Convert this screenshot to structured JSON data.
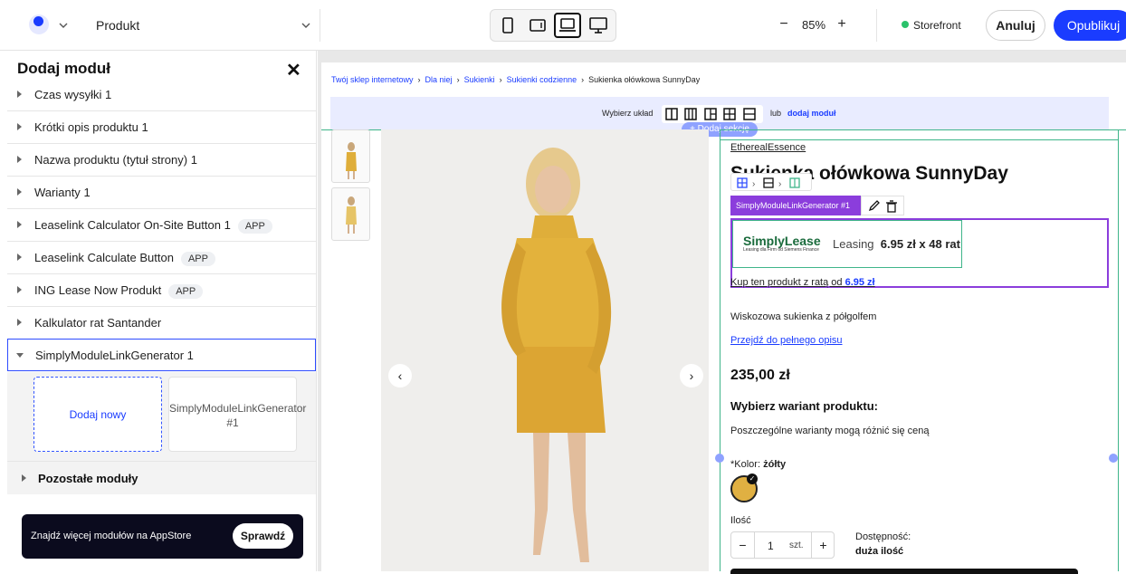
{
  "topbar": {
    "product_select": "Produkt",
    "zoom_value": "85%",
    "zoom_minus": "−",
    "zoom_plus": "+",
    "storefront": "Storefront",
    "cancel": "Anuluj",
    "publish": "Opublikuj",
    "devices": [
      "mobile-icon",
      "tablet-icon",
      "laptop-icon",
      "desktop-icon"
    ],
    "active_device": "laptop-icon"
  },
  "sidebar": {
    "title": "Dodaj moduł",
    "modules": [
      {
        "label": "Czas wysyłki",
        "count": "1",
        "app": ""
      },
      {
        "label": "Krótki opis produktu",
        "count": "1",
        "app": ""
      },
      {
        "label": "Nazwa produktu (tytuł strony)",
        "count": "1",
        "app": ""
      },
      {
        "label": "Warianty",
        "count": "1",
        "app": ""
      },
      {
        "label": "Leaselink Calculator On-Site Button",
        "count": "1",
        "app": "APP"
      },
      {
        "label": "Leaselink Calculate Button",
        "count": "",
        "app": "APP"
      },
      {
        "label": "ING Lease Now Produkt",
        "count": "",
        "app": "APP"
      },
      {
        "label": "Kalkulator rat Santander",
        "count": "",
        "app": ""
      },
      {
        "label": "SimplyModuleLinkGenerator",
        "count": "1",
        "app": ""
      }
    ],
    "add_new": "Dodaj nowy",
    "instance": "SimplyModuleLinkGenerator #1",
    "other_modules": "Pozostałe moduły",
    "appstore_text": "Znajdź więcej modułów na AppStore",
    "appstore_button": "Sprawdź"
  },
  "canvas": {
    "breadcrumb": [
      "Twój sklep internetowy",
      "Dla niej",
      "Sukienki",
      "Sukienki codzienne",
      "Sukienka ołówkowa SunnyDay"
    ],
    "layout_label": "Wybierz układ",
    "layout_or": "lub",
    "layout_add": "dodaj moduł",
    "add_section": "+ Dodaj sekcję",
    "brand": "EtherealEssence",
    "product_title": "Sukienka ołówkowa SunnyDay",
    "module_tag": "SimplyModuleLinkGenerator #1",
    "simplylease_logo": "SimplyLease",
    "simplylease_sub": "Leasing dla Firm od Siemens Finance",
    "leasing_label": "Leasing",
    "leasing_value": "6.95 zł x 48 rat",
    "kup_text": "Kup ten produkt z ratą od",
    "kup_value": "6.95 zł",
    "description": "Wiskozowa sukienka z półgolfem",
    "full_description": "Przejdź do pełnego opisu",
    "price": "235,00 zł",
    "variant_title": "Wybierz wariant produktu:",
    "variant_note": "Poszczególne warianty mogą różnić się ceną",
    "color_label": "*Kolor:",
    "color_value": "żółty",
    "color_hex": "#e0b042",
    "qty_label": "Ilość",
    "qty_value": "1",
    "qty_unit": "szt.",
    "availability_label": "Dostępność:",
    "availability_value": "duża ilość"
  },
  "colors": {
    "accent": "#1a3cff",
    "module_purple": "#8b3ddc",
    "green_outline": "#3fb58a"
  }
}
